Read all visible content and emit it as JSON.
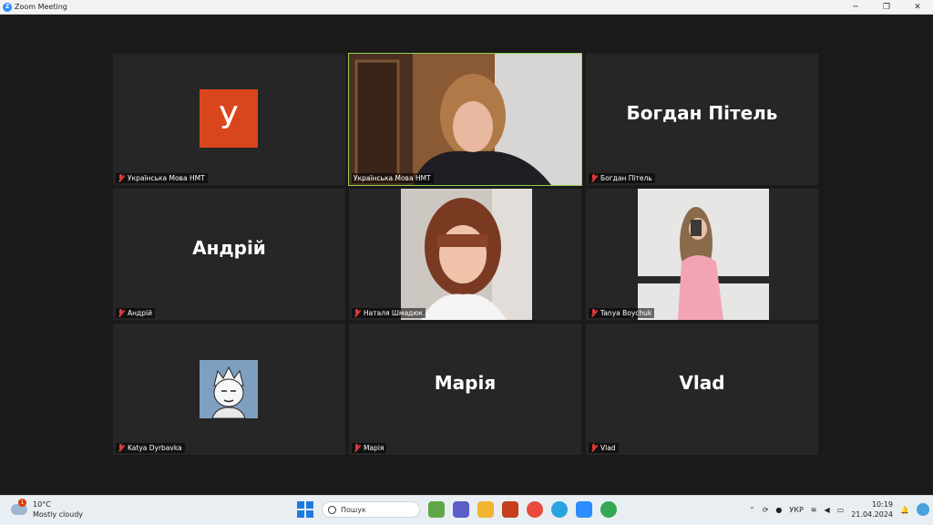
{
  "window": {
    "title": "Zoom Meeting",
    "app_icon_letter": "Z"
  },
  "controls": {
    "minimize": "─",
    "restore": "❐",
    "close": "✕"
  },
  "participants": [
    {
      "name": "Українська Мова НМТ",
      "display": "avatar",
      "avatar_letter": "У",
      "muted": true
    },
    {
      "name": "Українська Мова НМТ",
      "display": "video",
      "muted": false,
      "active_speaker": true
    },
    {
      "name": "Богдан Пітель",
      "display": "name",
      "big_name": "Богдан Пітель",
      "muted": true
    },
    {
      "name": "Андрій",
      "display": "name",
      "big_name": "Андрій",
      "muted": true
    },
    {
      "name": "Наталя Шмадюк",
      "display": "video",
      "muted": true
    },
    {
      "name": "Tanya Boychuk",
      "display": "video",
      "muted": true
    },
    {
      "name": "Katya Dyrbavka",
      "display": "avatar",
      "muted": true
    },
    {
      "name": "Марія",
      "display": "name",
      "big_name": "Марія",
      "muted": true
    },
    {
      "name": "Vlad",
      "display": "name",
      "big_name": "Vlad",
      "muted": true
    }
  ],
  "taskbar": {
    "weather": {
      "temp": "10°C",
      "condition": "Mostly cloudy",
      "badge": "1"
    },
    "search_placeholder": "Пошук",
    "language": "УКР",
    "time": "10:19",
    "date": "21.04.2024"
  },
  "colors": {
    "zoom_blue": "#2d8cff",
    "active_border": "#8fd14f",
    "avatar_orange": "#d9461e",
    "muted_red": "#e03a3a"
  }
}
